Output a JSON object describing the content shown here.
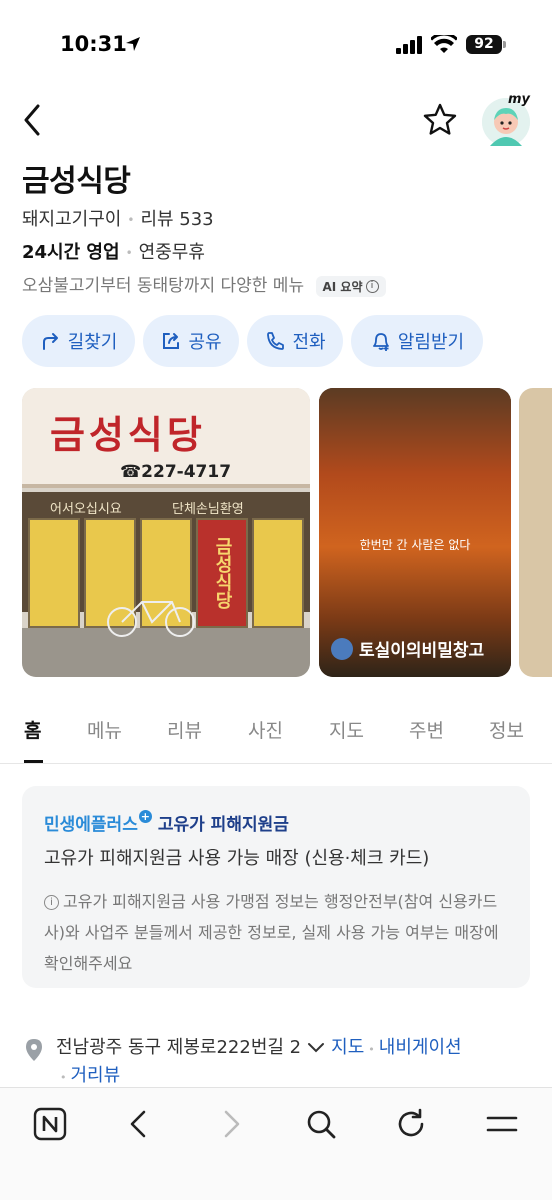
{
  "status_bar": {
    "time": "10:31",
    "battery": "92"
  },
  "header": {
    "back_icon": "chevron-left-icon",
    "favorite_icon": "star-outline-icon",
    "avatar_label": "my"
  },
  "place": {
    "name": "금성식당",
    "category": "돼지고기구이",
    "reviews": "리뷰 533",
    "hours": "24시간 영업",
    "holiday": "연중무휴",
    "summary": "오삼불고기부터 동태탕까지 다양한 메뉴",
    "ai_badge": "AI 요약"
  },
  "actions": [
    {
      "label": "길찾기",
      "icon": "directions-icon"
    },
    {
      "label": "공유",
      "icon": "share-icon"
    },
    {
      "label": "전화",
      "icon": "phone-icon"
    },
    {
      "label": "알림받기",
      "icon": "bell-plus-icon"
    }
  ],
  "photos": {
    "sign_text": "금성식당",
    "sign_phone": "☎227-4717",
    "sub_sign_left": "어서오십시요",
    "sub_sign_right": "단체손님환영",
    "door_text": "금성식당",
    "video_caption": "한번만 간 사람은 없다",
    "video_channel": "토실이의비밀창고"
  },
  "tabs": [
    "홈",
    "메뉴",
    "리뷰",
    "사진",
    "지도",
    "주변",
    "정보"
  ],
  "active_tab": "홈",
  "promo": {
    "brand": "민생에플러스",
    "brand_sub": "고유가 피해지원금",
    "headline": "고유가 피해지원금 사용 가능 매장 (신용·체크 카드)",
    "note": "고유가 피해지원금 사용 가맹점 정보는 행정안전부(참여 신용카드사)와 사업주 분들께서 제공한 정보로, 실제 사용 가능 여부는 매장에 확인해주세요"
  },
  "address": {
    "text": "전남광주 동구 제봉로222번길 2",
    "map_link": "지도",
    "navi_link": "내비게이션",
    "street_view_link": "거리뷰"
  },
  "bottom_bar": [
    "n-home-icon",
    "back-arrow-icon",
    "forward-arrow-icon",
    "search-icon",
    "refresh-icon",
    "menu-icon"
  ],
  "colors": {
    "accent": "#1f5fbf",
    "action_bg": "#e7f0fc",
    "promo_blue": "#2a8bd8"
  }
}
